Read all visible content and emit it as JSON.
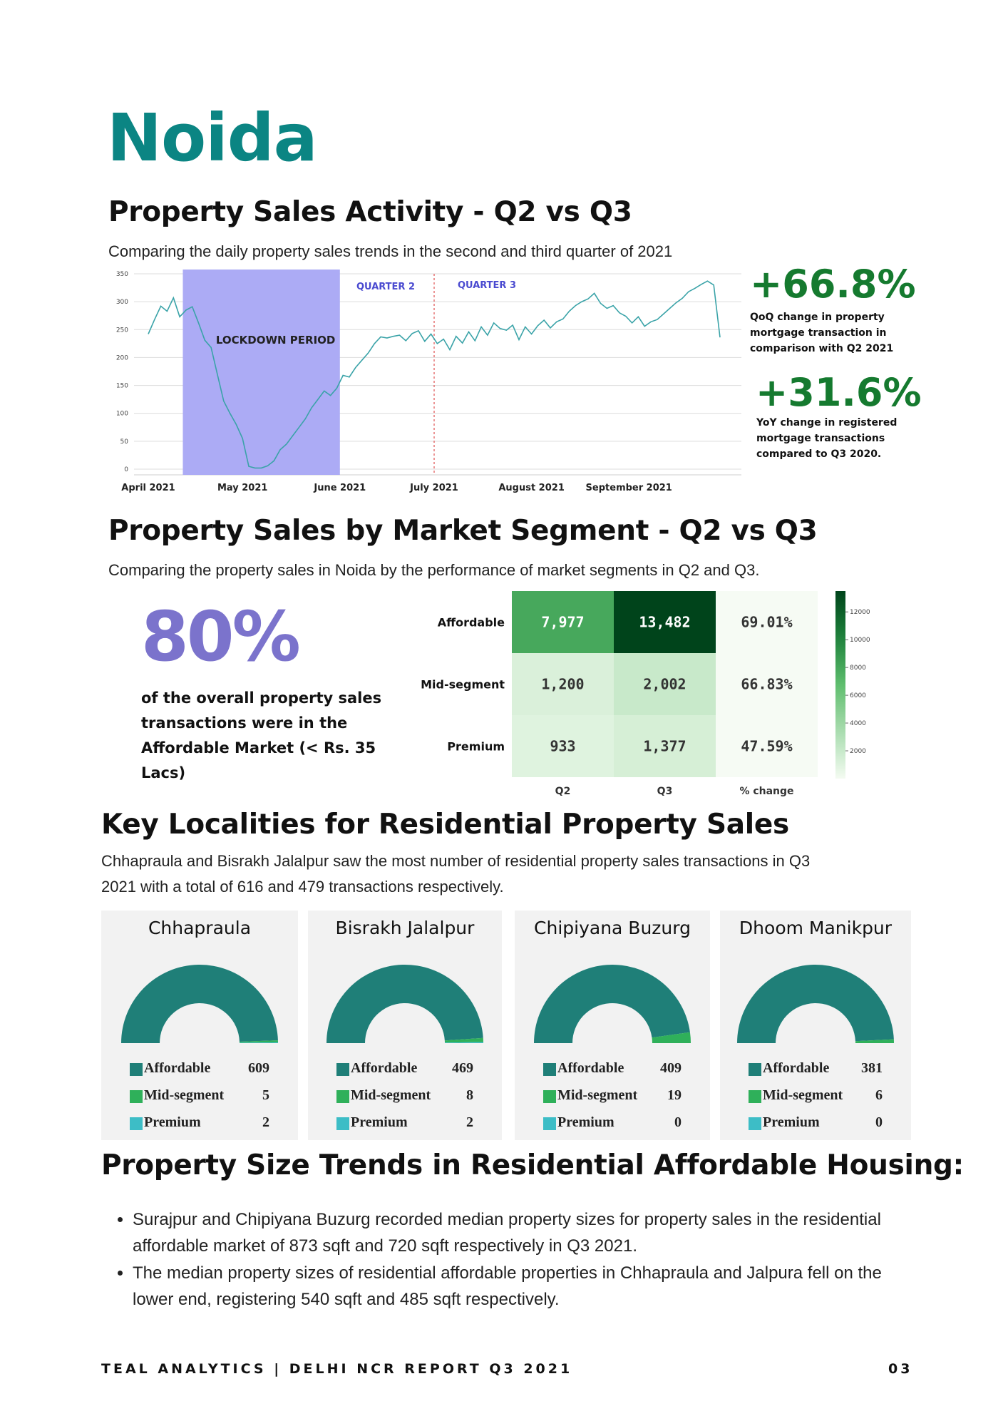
{
  "page": {
    "city": "Noida",
    "footer_left": "TEAL ANALYTICS | DELHI NCR REPORT Q3 2021",
    "footer_right": "03"
  },
  "sales_activity": {
    "title": "Property Sales Activity - Q2 vs Q3",
    "subtitle": "Comparing the daily property sales trends in the second and third quarter of 2021",
    "qoq_value": "+66.8%",
    "qoq_note": [
      "QoQ change in property",
      "mortgage transaction in",
      "comparison with Q2 2021"
    ],
    "yoy_value": "+31.6%",
    "yoy_note": [
      "YoY change in registered",
      "mortgage transactions",
      "compared to Q3 2020."
    ]
  },
  "segment": {
    "title": "Property Sales by Market Segment - Q2 vs Q3",
    "subtitle": "Comparing the property sales in Noida by the performance of market segments in Q2 and Q3.",
    "big_value": "80%",
    "big_note": [
      "of the overall property sales",
      "transactions were in the",
      "Affordable Market (< Rs. 35",
      "Lacs)"
    ]
  },
  "localities": {
    "title": "Key Localities for Residential Property Sales",
    "subtitle_lines": [
      "Chhapraula and Bisrakh Jalalpur saw the most number of residential property sales transactions in Q3",
      "2021 with a total of 616 and 479 transactions respectively."
    ]
  },
  "size_trends": {
    "title": "Property Size Trends in Residential Affordable Housing:",
    "bullets": [
      "Surajpur and Chipiyana Buzurg recorded median property sizes for property sales in the residential affordable market of 873 sqft and 720 sqft respectively in Q3 2021.",
      "The median property sizes of residential affordable properties in Chhapraula and Jalpura fell on the lower end, registering 540 sqft and 485 sqft respectively."
    ]
  },
  "colors": {
    "teal": "#0b8583",
    "green_stat": "#157a2f",
    "purple": "#7b73cc",
    "lockdown_band": "#acabf5",
    "line": "#3aa3a8",
    "quarter_label": "#4a4ad0",
    "affordable": "#1f7f78",
    "mid_segment": "#2fb05a",
    "premium": "#3dbdc6"
  },
  "chart_data": [
    {
      "type": "line",
      "x_ticks": [
        "April 2021",
        "May 2021",
        "June 2021",
        "July 2021",
        "August 2021",
        "September 2021"
      ],
      "ylim": [
        0,
        350
      ],
      "y_ticks": [
        0,
        50,
        100,
        150,
        200,
        250,
        300,
        350
      ],
      "grid": true,
      "annotations": {
        "lockdown_label": "LOCKDOWN PERIOD",
        "quarter2_label": "QUARTER 2",
        "quarter3_label": "QUARTER 3",
        "lockdown_start": "2021-04-12",
        "lockdown_end": "2021-06-01",
        "quarter_divider": "2021-07-01"
      },
      "start_date": "2021-04-01",
      "series": [
        {
          "values": [
            242,
            268,
            292,
            283,
            307,
            273,
            285,
            291,
            262,
            231,
            218,
            170,
            122,
            100,
            80,
            55,
            5,
            2,
            2,
            6,
            15,
            35,
            45,
            60,
            75,
            90,
            110,
            125,
            140,
            132,
            145,
            168,
            165,
            182,
            195,
            208,
            225,
            237,
            235,
            238,
            240,
            230,
            243,
            248,
            229,
            242,
            225,
            233,
            214,
            238,
            226,
            246,
            230,
            255,
            240,
            262,
            252,
            249,
            258,
            232,
            255,
            242,
            257,
            267,
            253,
            264,
            269,
            283,
            293,
            300,
            305,
            315,
            297,
            288,
            293,
            280,
            274,
            262,
            273,
            256,
            264,
            268,
            278,
            288,
            298,
            306,
            318,
            324,
            331,
            337,
            330,
            236
          ]
        }
      ]
    },
    {
      "type": "heatmap",
      "rows": [
        "Affordable",
        "Mid-segment",
        "Premium"
      ],
      "columns": [
        "Q2",
        "Q3",
        "% change"
      ],
      "cells": [
        [
          "7,977",
          "13,482",
          "69.01%"
        ],
        [
          "1,200",
          "2,002",
          "66.83%"
        ],
        [
          "933",
          "1,377",
          "47.59%"
        ]
      ],
      "values": [
        [
          7977,
          13482
        ],
        [
          1200,
          2002
        ],
        [
          933,
          1377
        ]
      ],
      "colorbar_ticks": [
        2000,
        4000,
        6000,
        8000,
        10000,
        12000
      ],
      "colorbar_range": [
        0,
        13500
      ]
    },
    {
      "type": "pie",
      "title": "Chhapraula",
      "labels": [
        "Affordable",
        "Mid-segment",
        "Premium"
      ],
      "values": [
        609,
        5,
        2
      ]
    },
    {
      "type": "pie",
      "title": "Bisrakh Jalalpur",
      "labels": [
        "Affordable",
        "Mid-segment",
        "Premium"
      ],
      "values": [
        469,
        8,
        2
      ]
    },
    {
      "type": "pie",
      "title": "Chipiyana Buzurg",
      "labels": [
        "Affordable",
        "Mid-segment",
        "Premium"
      ],
      "values": [
        409,
        19,
        0
      ]
    },
    {
      "type": "pie",
      "title": "Dhoom Manikpur",
      "labels": [
        "Affordable",
        "Mid-segment",
        "Premium"
      ],
      "values": [
        381,
        6,
        0
      ]
    }
  ]
}
